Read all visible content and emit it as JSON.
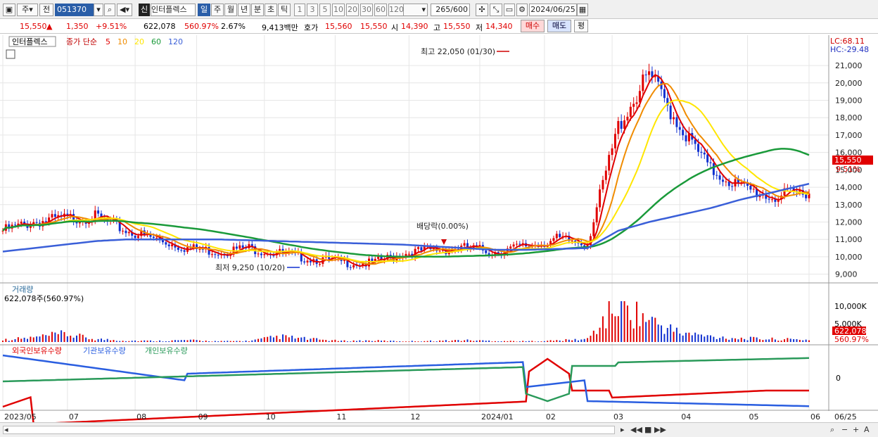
{
  "toolbar": {
    "market": "주",
    "mode": "전",
    "code": "051370",
    "badge": "신",
    "name": "인터플렉스",
    "periods": [
      "일",
      "주",
      "월",
      "년",
      "분",
      "초",
      "틱"
    ],
    "active_period": "일",
    "intervals": [
      "1",
      "3",
      "5",
      "10",
      "20",
      "30",
      "60",
      "120"
    ],
    "count": "265",
    "count_max": "/600",
    "date": "2024/06/25"
  },
  "quote": {
    "price": "15,550",
    "arrow": "▲",
    "change": "1,350",
    "change_pct": "+9.51%",
    "volume": "622,078",
    "vol_ratio": "560.97%",
    "turnover": "2.67%",
    "amount": "9,413백만",
    "ask_label": "호가",
    "ask": "15,560",
    "bid": "15,550",
    "open_label": "시",
    "open": "14,390",
    "high_label": "고",
    "high": "15,550",
    "low_label": "저",
    "low": "14,340",
    "buy": "매수",
    "sell": "매도",
    "avg": "평"
  },
  "price_panel": {
    "stock_label": "인터플렉스",
    "ma_label": "종가 단순",
    "ma_periods": [
      "5",
      "10",
      "20",
      "60",
      "120"
    ],
    "ma_colors": [
      "#e00000",
      "#f08c00",
      "#ffe600",
      "#1a9a3a",
      "#3a5fd8"
    ],
    "lc": "LC:68.11",
    "hc": "HC:-29.48",
    "y_ticks": [
      "21,000",
      "20,000",
      "19,000",
      "18,000",
      "17,000",
      "16,000",
      "15,000",
      "14,000",
      "13,000",
      "12,000",
      "11,000",
      "10,000",
      "9,000"
    ],
    "price_tag": "15,550",
    "pct_tag": "9.51%",
    "high_note": "최고 22,050 (01/30)",
    "low_note": "최저 9,250 (10/20)",
    "div_note": "배당락(0.00%)"
  },
  "volume_panel": {
    "title": "거래량",
    "value": "622,078주(560.97%)",
    "y_ticks": [
      "10,000K",
      "5,000K"
    ],
    "tag": "622,078",
    "tag2": "560.97%"
  },
  "holding_panel": {
    "series": [
      "외국인보유수량",
      "기관보유수량",
      "개인보유수량"
    ],
    "colors": [
      "#e00000",
      "#2a5ee0",
      "#2a9a5a"
    ],
    "zero": "0"
  },
  "x_axis": [
    "2023/05",
    "07",
    "08",
    "09",
    "10",
    "11",
    "12",
    "2024/01",
    "02",
    "03",
    "04",
    "05",
    "06",
    "06/25"
  ],
  "chart_data": {
    "type": "line",
    "title": "인터플렉스",
    "ylim": [
      8500,
      22500
    ],
    "price_x": [
      0,
      10,
      20,
      30,
      40,
      50,
      60,
      70,
      80,
      90,
      100,
      110,
      120,
      130,
      140,
      150,
      160,
      170,
      180,
      190,
      200,
      210,
      220,
      230,
      240,
      250,
      262
    ],
    "close": [
      11500,
      12000,
      12200,
      12300,
      11500,
      11000,
      10500,
      10300,
      10500,
      10200,
      9900,
      9700,
      9600,
      10200,
      10400,
      10500,
      10300,
      10600,
      11000,
      10800,
      17500,
      20500,
      17500,
      15000,
      14000,
      13400,
      13800
    ],
    "ma120": [
      10300,
      10500,
      10700,
      10900,
      11000,
      11000,
      11000,
      11000,
      10950,
      10900,
      10850,
      10800,
      10750,
      10700,
      10600,
      10500,
      10400,
      10400,
      10450,
      10500,
      11500,
      12000,
      12400,
      12800,
      13300,
      13700,
      14200
    ],
    "volume_k": [
      600,
      1200,
      2200,
      800,
      400,
      300,
      500,
      200,
      300,
      1500,
      800,
      300,
      400,
      200,
      300,
      500,
      300,
      200,
      400,
      800,
      10500,
      6000,
      2500,
      1500,
      1000,
      800,
      622
    ],
    "x_labels": [
      "2023/05",
      "07",
      "08",
      "09",
      "10",
      "11",
      "12",
      "2024/01",
      "02",
      "03",
      "04",
      "05",
      "06",
      "06/25"
    ]
  }
}
